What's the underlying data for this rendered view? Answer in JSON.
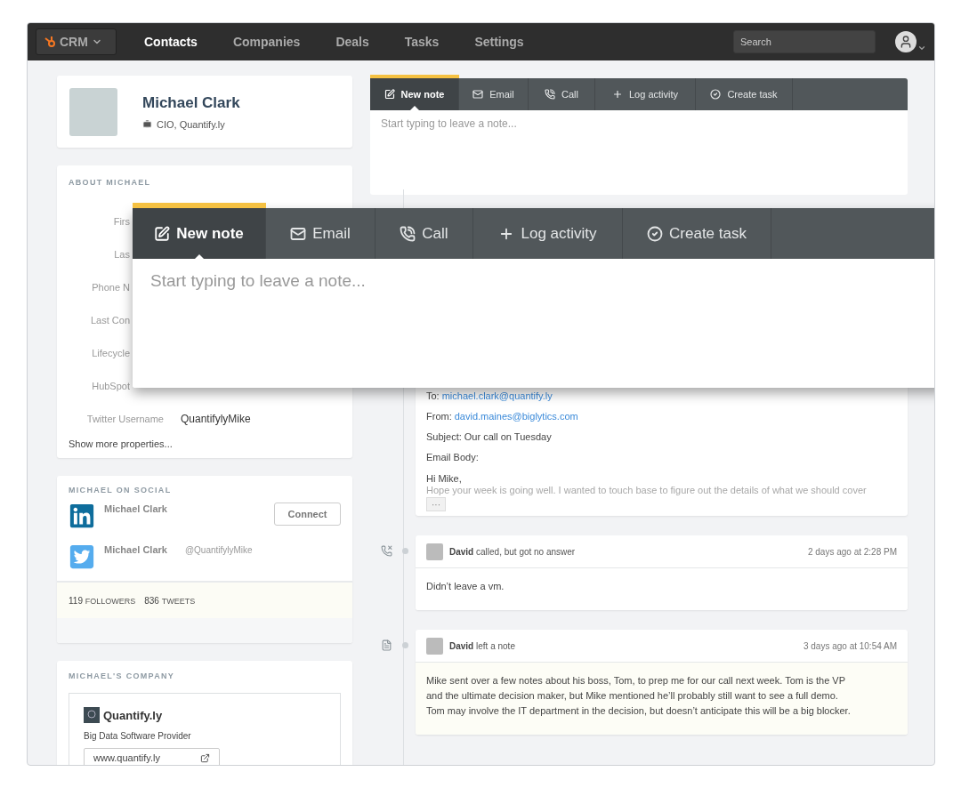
{
  "nav": {
    "brand": "CRM",
    "items": [
      {
        "label": "Contacts",
        "selected": true
      },
      {
        "label": "Companies",
        "selected": false
      },
      {
        "label": "Deals",
        "selected": false
      },
      {
        "label": "Tasks",
        "selected": false
      },
      {
        "label": "Settings",
        "selected": false
      }
    ],
    "search": {
      "placeholder": "Search"
    }
  },
  "contact": {
    "name": "Michael Clark",
    "title": "CIO, Quantify.ly"
  },
  "about": {
    "heading": "ABOUT MICHAEL",
    "properties": [
      {
        "label": "Firs"
      },
      {
        "label": "Las"
      },
      {
        "label": "Phone N"
      },
      {
        "label": "Last Con"
      },
      {
        "label": "Lifecycle"
      },
      {
        "label": "HubSpot"
      },
      {
        "label": "Twitter Username",
        "value": "QuantifylyMike"
      }
    ],
    "more": "Show more properties..."
  },
  "social": {
    "heading": "MICHAEL ON SOCIAL",
    "accounts": [
      {
        "kind": "linkedin",
        "name": "Michael Clark",
        "button": "Connect"
      },
      {
        "kind": "twitter",
        "name": "Michael Clark",
        "handle": "@QuantifylyMike"
      }
    ],
    "stats": [
      {
        "count": "119",
        "label": "FOLLOWERS"
      },
      {
        "count": "836",
        "label": "TWEETS"
      }
    ]
  },
  "company": {
    "heading": "MICHAEL'S COMPANY",
    "name": "Quantify.ly",
    "description": "Big Data Software Provider",
    "website": "www.quantify.ly"
  },
  "composer": {
    "tabs": [
      {
        "kind": "note",
        "label": "New note",
        "selected": true
      },
      {
        "kind": "email",
        "label": "Email",
        "selected": false
      },
      {
        "kind": "call",
        "label": "Call",
        "selected": false
      },
      {
        "kind": "log",
        "label": "Log activity",
        "selected": false
      },
      {
        "kind": "task",
        "label": "Create task",
        "selected": false
      }
    ],
    "placeholder": "Start typing to leave a note..."
  },
  "composer_enlarged": {
    "tabs": [
      {
        "kind": "note",
        "label": "New note",
        "selected": true
      },
      {
        "kind": "email",
        "label": "Email",
        "selected": false
      },
      {
        "kind": "call",
        "label": "Call",
        "selected": false
      },
      {
        "kind": "log",
        "label": "Log activity",
        "selected": false
      },
      {
        "kind": "task",
        "label": "Create task",
        "selected": false
      }
    ],
    "placeholder": "Start typing to leave a note..."
  },
  "timeline": [
    {
      "kind": "email",
      "fields": [
        {
          "label": "To:",
          "value": "michael.clark@quantify.ly"
        },
        {
          "label": "From:",
          "value": "david.maines@biglytics.com"
        },
        {
          "label": "Subject: Our call on Tuesday"
        },
        {
          "label": "Email Body:"
        }
      ],
      "greeting": "Hi Mike,",
      "preview": "Hope your week is going well. I wanted to touch base to figure out the details of what we should cover",
      "more": "···"
    },
    {
      "kind": "call",
      "author": "David",
      "action": "called, but got no answer",
      "time": "2 days ago at 2:28 PM",
      "body": [
        "Didn’t leave a vm."
      ]
    },
    {
      "kind": "note",
      "author": "David",
      "action": "left a note",
      "time": "3 days ago at 10:54 AM",
      "body": [
        "Mike sent over a few notes about his boss, Tom, to prep me for our call next week. Tom is the VP",
        "and the ultimate decision maker, but Mike mentioned he’ll probably still want to see a full demo.",
        "Tom may involve the IT department in the decision, but doesn’t anticipate this will be a big blocker."
      ]
    }
  ]
}
